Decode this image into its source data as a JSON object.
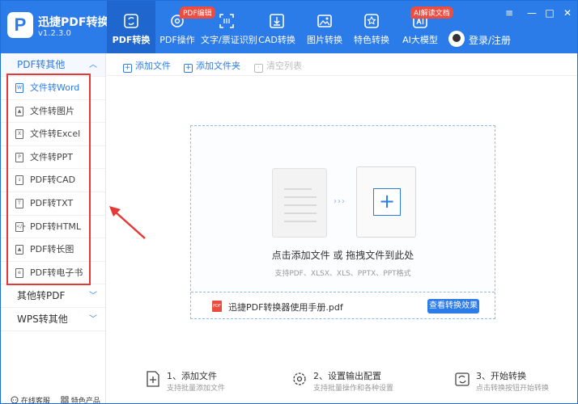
{
  "app": {
    "name": "迅捷PDF转换器",
    "version": "v1.2.3.0",
    "logo_letter": "P",
    "brand_color": "#2b7be8"
  },
  "nav": [
    {
      "label": "PDF转换",
      "icon": "refresh-pdf-icon",
      "active": true
    },
    {
      "label": "PDF操作",
      "icon": "gear-doc-icon",
      "badge": "PDF编辑"
    },
    {
      "label": "文字/票证识别",
      "icon": "scan-frame-icon"
    },
    {
      "label": "CAD转换",
      "icon": "cad-download-icon"
    },
    {
      "label": "图片转换",
      "icon": "image-icon"
    },
    {
      "label": "特色转换",
      "icon": "star-refresh-icon"
    },
    {
      "label": "AI大模型",
      "icon": "ai-icon",
      "badge": "AI解读文档"
    }
  ],
  "user": {
    "login_label": "登录/注册"
  },
  "window_controls": {
    "menu": "≡",
    "minimize": "—",
    "maximize": "□",
    "close": "✕"
  },
  "sidebar": {
    "categories": [
      {
        "label": "PDF转其他",
        "chevron": "︿"
      },
      {
        "label": "其他转PDF",
        "chevron": "﹀"
      },
      {
        "label": "WPS转其他",
        "chevron": "﹀"
      }
    ],
    "items": [
      {
        "label": "文件转Word",
        "glyph": "W"
      },
      {
        "label": "文件转图片",
        "glyph": "▲"
      },
      {
        "label": "文件转Excel",
        "glyph": "X"
      },
      {
        "label": "文件转PPT",
        "glyph": "P"
      },
      {
        "label": "PDF转CAD",
        "glyph": "↓"
      },
      {
        "label": "PDF转TXT",
        "glyph": "T"
      },
      {
        "label": "PDF转HTML",
        "glyph": "</>"
      },
      {
        "label": "PDF转长图",
        "glyph": "▲"
      },
      {
        "label": "PDF转电子书",
        "glyph": "e"
      }
    ],
    "bottom": [
      {
        "label": "在线客服",
        "icon": "chat-icon"
      },
      {
        "label": "特色产品",
        "icon": "grid-icon"
      }
    ]
  },
  "toolbar": {
    "add_file": "添加文件",
    "add_folder": "添加文件夹",
    "clear_list": "清空列表"
  },
  "dropzone": {
    "title": "点击添加文件 或 拖拽文件到此处",
    "subtitle": "支持PDF、XLSX、XLS、PPTX、PPT格式",
    "arrows": "›››",
    "plus": "+",
    "manual_file": "迅捷PDF转换器使用手册.pdf",
    "pdf_badge": "PDF",
    "effect_button": "查看转换效果"
  },
  "steps": [
    {
      "title": "1、添加文件",
      "desc": "支持批量添加文件",
      "icon": "add-file-icon"
    },
    {
      "title": "2、设置输出配置",
      "desc": "支持批量操作和各种设置",
      "icon": "settings-gear-icon"
    },
    {
      "title": "3、开始转换",
      "desc": "点击转换按钮开始转换",
      "icon": "convert-icon"
    }
  ],
  "colors": {
    "accent": "#2b7be8",
    "annotation_red": "#e53935",
    "badge_red": "#ef4b3f"
  }
}
